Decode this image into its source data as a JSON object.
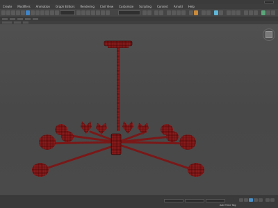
{
  "menu": [
    {
      "label": "Create"
    },
    {
      "label": "Modifiers"
    },
    {
      "label": "Animation"
    },
    {
      "label": "Graph Editors"
    },
    {
      "label": "Rendering"
    },
    {
      "label": "Civil View"
    },
    {
      "label": "Customize"
    },
    {
      "label": "Scripting"
    },
    {
      "label": "Content"
    },
    {
      "label": "Arnold"
    },
    {
      "label": "Help"
    }
  ],
  "statusbar": {
    "add_time_tag": "Add Time Tag"
  },
  "colors": {
    "model": "#8a1c1c",
    "wire": "#3a0000",
    "viewport_bg": "#4b4b4b",
    "highlight": "#3e84c6"
  },
  "icons": [
    "select-icon",
    "move-icon",
    "rotate-icon",
    "scale-icon",
    "snap-icon",
    "undo-icon",
    "redo-icon",
    "link-icon",
    "render-icon",
    "viewcube-icon",
    "play-icon"
  ]
}
